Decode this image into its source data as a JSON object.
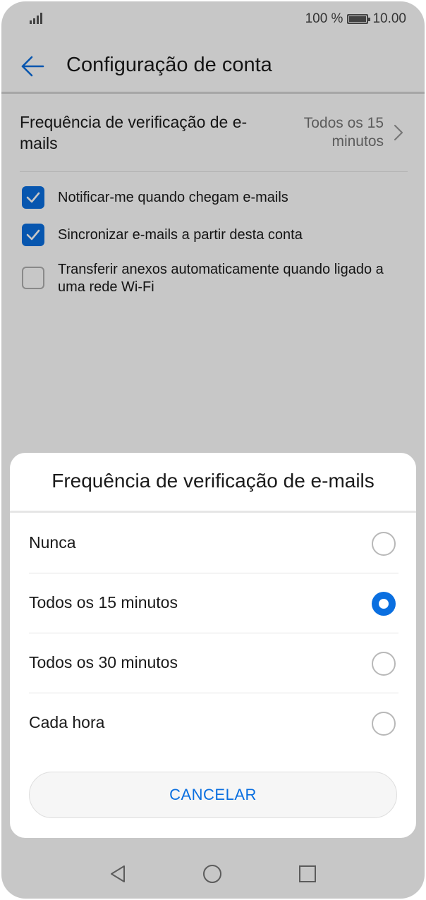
{
  "status_bar": {
    "battery": "100 %",
    "time": "10.00"
  },
  "app_bar": {
    "title": "Configuração de conta"
  },
  "settings": {
    "frequency": {
      "label": "Frequência de verificação de e-mails",
      "value": "Todos os 15 minutos"
    },
    "checkboxes": [
      {
        "label": "Notificar-me quando chegam e-mails",
        "checked": true
      },
      {
        "label": "Sincronizar e-mails a partir desta conta",
        "checked": true
      },
      {
        "label": "Transferir anexos automaticamente quando ligado a uma rede Wi-Fi",
        "checked": false
      }
    ]
  },
  "dialog": {
    "title": "Frequência de verificação de e-mails",
    "options": [
      {
        "label": "Nunca",
        "selected": false
      },
      {
        "label": "Todos os 15 minutos",
        "selected": true
      },
      {
        "label": "Todos os 30 minutos",
        "selected": false
      },
      {
        "label": "Cada hora",
        "selected": false
      }
    ],
    "cancel_label": "CANCELAR"
  },
  "colors": {
    "accent": "#0a6fe0",
    "text": "#1a1a1a",
    "secondary_text": "#777777"
  },
  "icons": {
    "back": "arrow-left-icon",
    "chevron": "chevron-right-icon",
    "nav_back": "triangle-back-icon",
    "nav_home": "circle-home-icon",
    "nav_recents": "square-recents-icon"
  }
}
